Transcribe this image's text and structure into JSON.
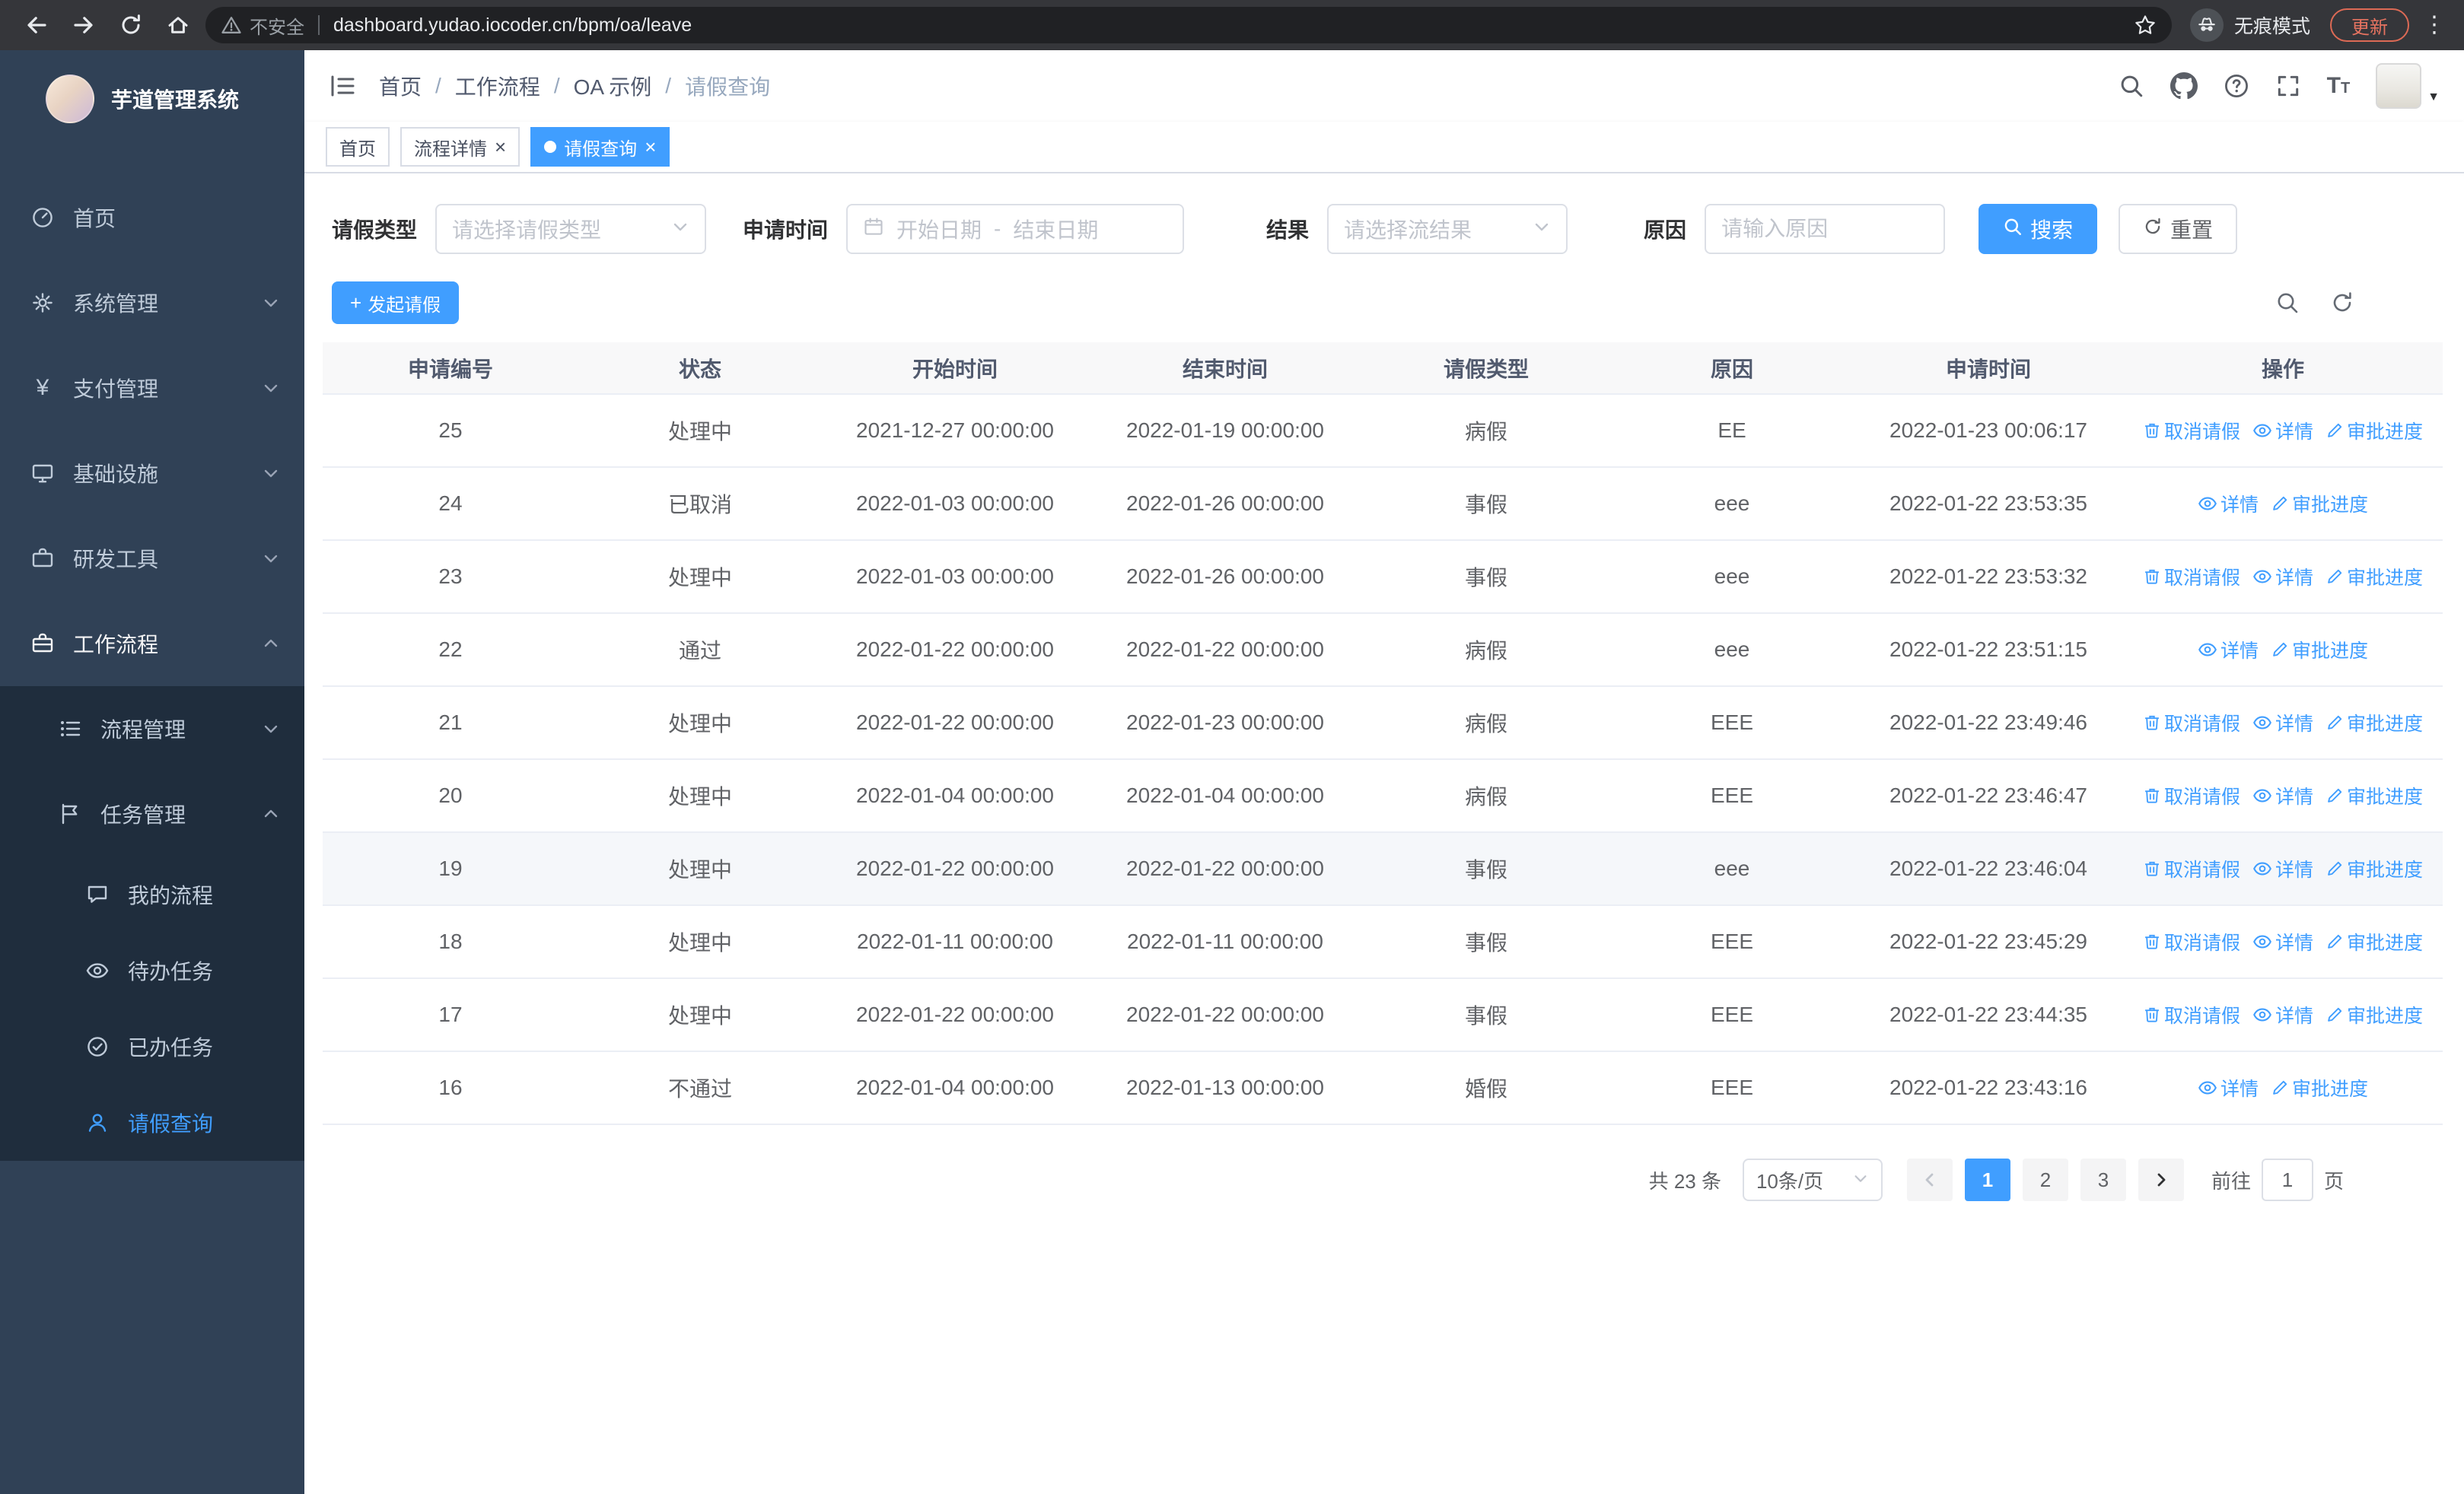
{
  "browser": {
    "security_warning": "不安全",
    "url": "dashboard.yudao.iocoder.cn/bpm/oa/leave",
    "incognito_label": "无痕模式",
    "update_button": "更新"
  },
  "sidebar": {
    "logo_title": "芋道管理系统",
    "items": [
      {
        "label": "首页"
      },
      {
        "label": "系统管理"
      },
      {
        "label": "支付管理"
      },
      {
        "label": "基础设施"
      },
      {
        "label": "研发工具"
      },
      {
        "label": "工作流程"
      },
      {
        "label": "流程管理"
      },
      {
        "label": "任务管理"
      },
      {
        "label": "我的流程"
      },
      {
        "label": "待办任务"
      },
      {
        "label": "已办任务"
      },
      {
        "label": "请假查询"
      }
    ]
  },
  "header": {
    "breadcrumb": [
      "首页",
      "工作流程",
      "OA 示例",
      "请假查询"
    ]
  },
  "tabs": [
    {
      "label": "首页",
      "closable": false,
      "active": false
    },
    {
      "label": "流程详情",
      "closable": true,
      "active": false
    },
    {
      "label": "请假查询",
      "closable": true,
      "active": true
    }
  ],
  "filters": {
    "leave_type_label": "请假类型",
    "leave_type_placeholder": "请选择请假类型",
    "apply_time_label": "申请时间",
    "start_date_placeholder": "开始日期",
    "range_separator": "-",
    "end_date_placeholder": "结束日期",
    "result_label": "结果",
    "result_placeholder": "请选择流结果",
    "reason_label": "原因",
    "reason_placeholder": "请输入原因",
    "search_button": "搜索",
    "reset_button": "重置"
  },
  "toolbar": {
    "create_button": "发起请假"
  },
  "table": {
    "columns": [
      "申请编号",
      "状态",
      "开始时间",
      "结束时间",
      "请假类型",
      "原因",
      "申请时间",
      "操作"
    ],
    "actions": {
      "cancel": "取消请假",
      "detail": "详情",
      "progress": "审批进度"
    },
    "rows": [
      {
        "id": "25",
        "status": "处理中",
        "start": "2021-12-27 00:00:00",
        "end": "2022-01-19 00:00:00",
        "type": "病假",
        "reason": "EE",
        "apply_time": "2022-01-23 00:06:17",
        "cancellable": true,
        "hover": false
      },
      {
        "id": "24",
        "status": "已取消",
        "start": "2022-01-03 00:00:00",
        "end": "2022-01-26 00:00:00",
        "type": "事假",
        "reason": "eee",
        "apply_time": "2022-01-22 23:53:35",
        "cancellable": false,
        "hover": false
      },
      {
        "id": "23",
        "status": "处理中",
        "start": "2022-01-03 00:00:00",
        "end": "2022-01-26 00:00:00",
        "type": "事假",
        "reason": "eee",
        "apply_time": "2022-01-22 23:53:32",
        "cancellable": true,
        "hover": false
      },
      {
        "id": "22",
        "status": "通过",
        "start": "2022-01-22 00:00:00",
        "end": "2022-01-22 00:00:00",
        "type": "病假",
        "reason": "eee",
        "apply_time": "2022-01-22 23:51:15",
        "cancellable": false,
        "hover": false
      },
      {
        "id": "21",
        "status": "处理中",
        "start": "2022-01-22 00:00:00",
        "end": "2022-01-23 00:00:00",
        "type": "病假",
        "reason": "EEE",
        "apply_time": "2022-01-22 23:49:46",
        "cancellable": true,
        "hover": false
      },
      {
        "id": "20",
        "status": "处理中",
        "start": "2022-01-04 00:00:00",
        "end": "2022-01-04 00:00:00",
        "type": "病假",
        "reason": "EEE",
        "apply_time": "2022-01-22 23:46:47",
        "cancellable": true,
        "hover": false
      },
      {
        "id": "19",
        "status": "处理中",
        "start": "2022-01-22 00:00:00",
        "end": "2022-01-22 00:00:00",
        "type": "事假",
        "reason": "eee",
        "apply_time": "2022-01-22 23:46:04",
        "cancellable": true,
        "hover": true
      },
      {
        "id": "18",
        "status": "处理中",
        "start": "2022-01-11 00:00:00",
        "end": "2022-01-11 00:00:00",
        "type": "事假",
        "reason": "EEE",
        "apply_time": "2022-01-22 23:45:29",
        "cancellable": true,
        "hover": false
      },
      {
        "id": "17",
        "status": "处理中",
        "start": "2022-01-22 00:00:00",
        "end": "2022-01-22 00:00:00",
        "type": "事假",
        "reason": "EEE",
        "apply_time": "2022-01-22 23:44:35",
        "cancellable": true,
        "hover": false
      },
      {
        "id": "16",
        "status": "不通过",
        "start": "2022-01-04 00:00:00",
        "end": "2022-01-13 00:00:00",
        "type": "婚假",
        "reason": "EEE",
        "apply_time": "2022-01-22 23:43:16",
        "cancellable": false,
        "hover": false
      }
    ]
  },
  "pagination": {
    "total": "共 23 条",
    "page_size": "10条/页",
    "pages": [
      "1",
      "2",
      "3"
    ],
    "active_page": "1",
    "goto_label": "前往",
    "goto_value": "1",
    "goto_suffix": "页"
  },
  "icons": {
    "browser_menu_glyph": "⋮",
    "avatar_caret_glyph": "▼",
    "yen_glyph": "¥",
    "plus_glyph": "+",
    "close_glyph": "×",
    "question_glyph": "?",
    "font_size_glyph_big": "T",
    "font_size_glyph_small": "T",
    "range_sep_glyph": "-"
  },
  "colors": {
    "primary": "#409eff",
    "sidebar_bg": "#304156",
    "submenu_bg": "#1f2d3d",
    "table_header_bg": "#f8f8f9",
    "update_accent": "#e57360"
  }
}
